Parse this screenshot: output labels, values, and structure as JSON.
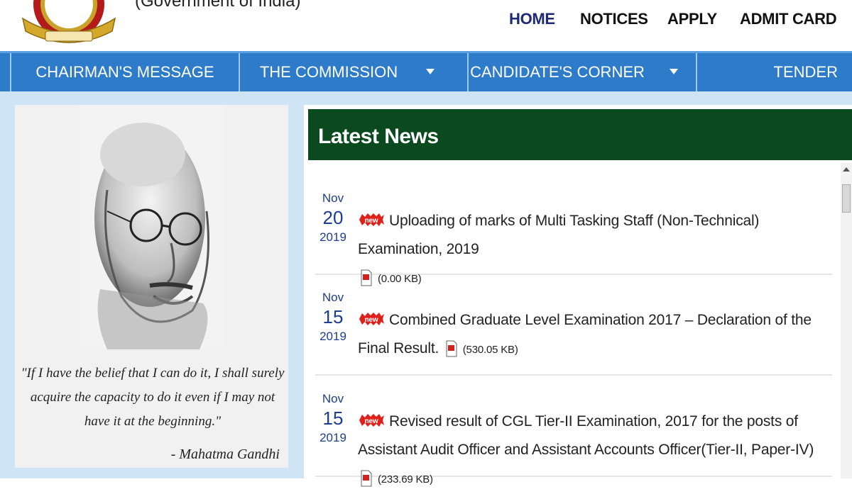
{
  "header": {
    "gov_title": "(Government of India)",
    "nav": [
      "HOME",
      "NOTICES",
      "APPLY",
      "ADMIT CARD"
    ]
  },
  "menu": {
    "items": [
      {
        "label": "CHAIRMAN'S MESSAGE",
        "dropdown": false
      },
      {
        "label": "THE COMMISSION",
        "dropdown": true
      },
      {
        "label": "CANDIDATE'S CORNER",
        "dropdown": true
      },
      {
        "label": "TENDER",
        "dropdown": false
      }
    ]
  },
  "quote": {
    "text": "\"If I have the belief that I can do it, I shall surely acquire the capacity to do it even if I may not have it at the beginning.\"",
    "author": "- Mahatma Gandhi"
  },
  "news": {
    "title": "Latest News",
    "items": [
      {
        "month": "Nov",
        "day": "20",
        "year": "2019",
        "text": "Uploading of marks of Multi Tasking Staff (Non-Technical) Examination, 2019",
        "size": "(0.00 KB)"
      },
      {
        "month": "Nov",
        "day": "15",
        "year": "2019",
        "text": "Combined Graduate Level Examination 2017 – Declaration of the Final Result.",
        "size": "(530.05 KB)"
      },
      {
        "month": "Nov",
        "day": "15",
        "year": "2019",
        "text": "Revised result of CGL Tier-II Examination, 2017 for the posts of Assistant Audit Officer and Assistant Accounts Officer(Tier-II, Paper-IV)",
        "size": "(233.69 KB)"
      }
    ]
  },
  "colors": {
    "menu_blue": "#2e7bc9",
    "news_header_green": "#0a4a1e",
    "date_blue": "#1e3d8f",
    "active_nav": "#1e2a78",
    "page_bg": "#cfe5f6"
  }
}
